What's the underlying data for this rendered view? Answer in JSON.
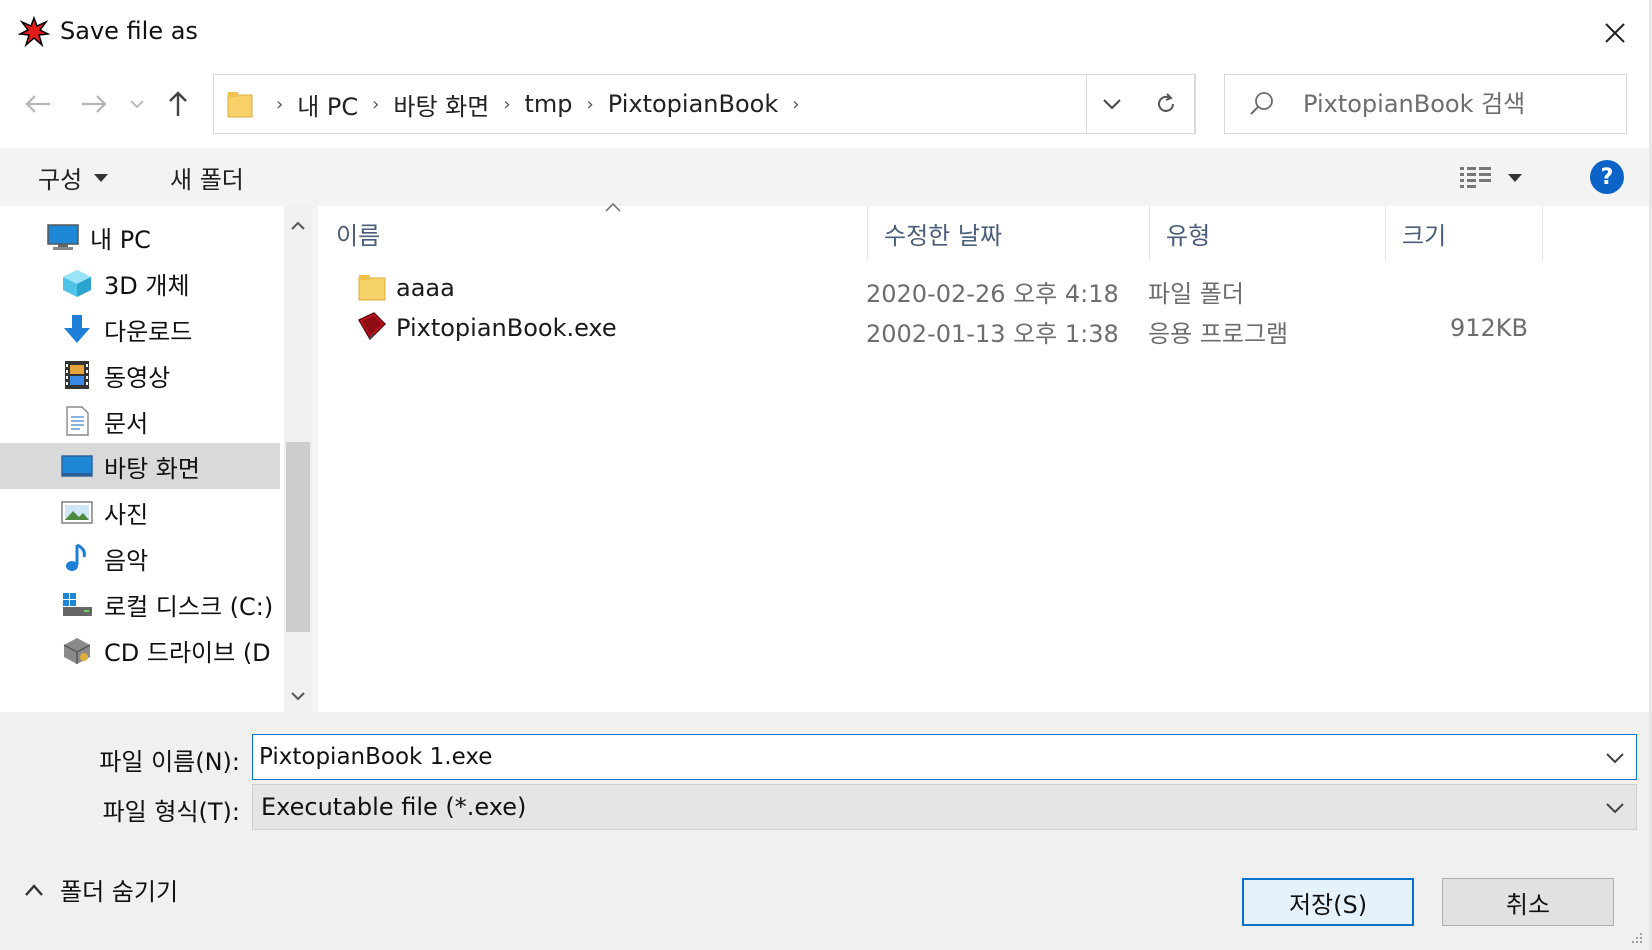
{
  "window": {
    "title": "Save file as",
    "close_label": "×"
  },
  "address": {
    "crumbs": [
      "내 PC",
      "바탕 화면",
      "tmp",
      "PixtopianBook"
    ],
    "separator": "›"
  },
  "search": {
    "placeholder": "PixtopianBook 검색"
  },
  "toolbar": {
    "organize_label": "구성",
    "new_folder_label": "새 폴더",
    "help_label": "?"
  },
  "navpane": {
    "items": [
      {
        "label": "내 PC",
        "icon": "computer-icon"
      },
      {
        "label": "3D 개체",
        "icon": "3d-objects-icon"
      },
      {
        "label": "다운로드",
        "icon": "download-icon"
      },
      {
        "label": "동영상",
        "icon": "video-icon"
      },
      {
        "label": "문서",
        "icon": "document-icon"
      },
      {
        "label": "바탕 화면",
        "icon": "desktop-icon",
        "selected": true
      },
      {
        "label": "사진",
        "icon": "pictures-icon"
      },
      {
        "label": "음악",
        "icon": "music-icon"
      },
      {
        "label": "로컬 디스크 (C:)",
        "icon": "local-disk-icon"
      },
      {
        "label": "CD 드라이브 (D",
        "icon": "cd-drive-icon"
      }
    ]
  },
  "filelist": {
    "columns": [
      "이름",
      "수정한 날짜",
      "유형",
      "크기"
    ],
    "rows": [
      {
        "name": "aaaa",
        "modified": "2020-02-26 오후 4:18",
        "type": "파일 폴더",
        "size": "",
        "icon": "folder-icon"
      },
      {
        "name": "PixtopianBook.exe",
        "modified": "2002-01-13 오후 1:38",
        "type": "응용 프로그램",
        "size": "912KB",
        "icon": "app-exe-icon"
      }
    ]
  },
  "form": {
    "filename_label": "파일 이름(N):",
    "filename_value": "PixtopianBook 1.exe",
    "filetype_label": "파일 형식(T):",
    "filetype_value": "Executable file (*.exe)"
  },
  "footer": {
    "hide_folders_label": "폴더 숨기기",
    "save_label": "저장(S)",
    "cancel_label": "취소"
  },
  "colors": {
    "accent": "#0a72d0",
    "selected_nav": "#d9d9d9",
    "toolbar_bg": "#f3f3f3",
    "help_blue": "#0b63c8",
    "folder_yellow": "#f7d268"
  }
}
